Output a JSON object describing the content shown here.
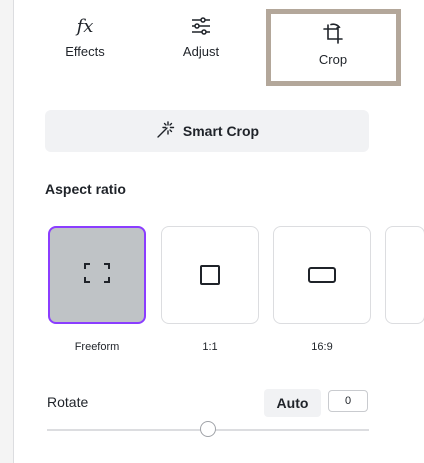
{
  "tabs": [
    {
      "label": "Effects",
      "icon": "fx-icon",
      "glyph": "fx"
    },
    {
      "label": "Adjust",
      "icon": "sliders-icon"
    },
    {
      "label": "Crop",
      "icon": "crop-icon",
      "selected": true
    }
  ],
  "smart_crop": {
    "label": "Smart Crop",
    "icon": "magic-wand-icon"
  },
  "aspect_ratio": {
    "title": "Aspect ratio",
    "options": [
      {
        "label": "Freeform",
        "icon": "freeform-corners-icon",
        "selected": true
      },
      {
        "label": "1:1",
        "icon": "square-icon"
      },
      {
        "label": "16:9",
        "icon": "wide-rectangle-icon"
      }
    ]
  },
  "rotate": {
    "label": "Rotate",
    "auto_label": "Auto",
    "value": "0",
    "slider_fraction": 0.5
  },
  "colors": {
    "selection": "#8b3dff",
    "selected_card_bg": "#bfc3c6",
    "highlight_frame": "#b3a79a"
  }
}
